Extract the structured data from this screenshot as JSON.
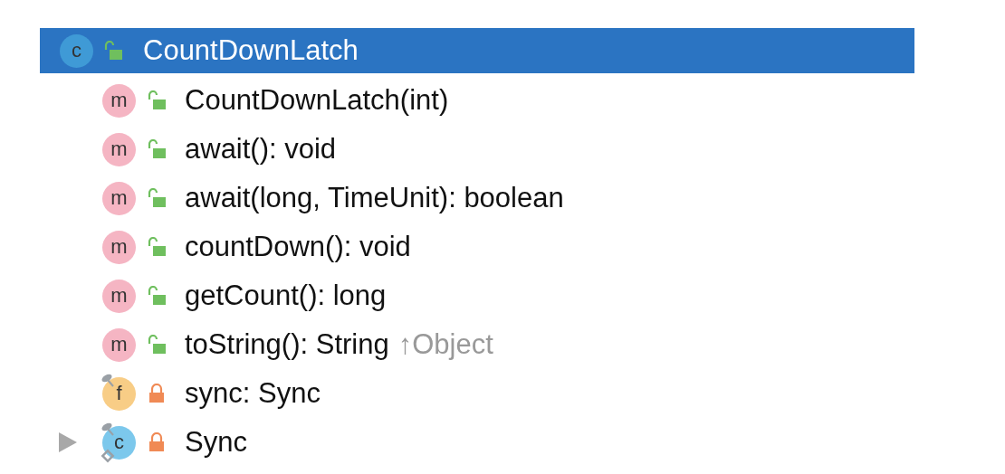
{
  "tree": {
    "kind": "class",
    "badge": "c",
    "private": false,
    "label": "CountDownLatch",
    "selected": true,
    "children": [
      {
        "kind": "method",
        "badge": "m",
        "private": false,
        "label": "CountDownLatch(int)",
        "selected": false,
        "final": false,
        "static": false
      },
      {
        "kind": "method",
        "badge": "m",
        "private": false,
        "label": "await(): void",
        "selected": false,
        "final": false,
        "static": false
      },
      {
        "kind": "method",
        "badge": "m",
        "private": false,
        "label": "await(long, TimeUnit): boolean",
        "selected": false,
        "final": false,
        "static": false
      },
      {
        "kind": "method",
        "badge": "m",
        "private": false,
        "label": "countDown(): void",
        "selected": false,
        "final": false,
        "static": false
      },
      {
        "kind": "method",
        "badge": "m",
        "private": false,
        "label": "getCount(): long",
        "selected": false,
        "final": false,
        "static": false
      },
      {
        "kind": "method",
        "badge": "m",
        "private": false,
        "label": "toString(): String",
        "suffix": "↑Object",
        "selected": false,
        "final": false,
        "static": false
      },
      {
        "kind": "field",
        "badge": "f",
        "private": true,
        "label": "sync: Sync",
        "selected": false,
        "final": true,
        "static": false
      },
      {
        "kind": "class",
        "badge": "c",
        "private": true,
        "label": "Sync",
        "selected": false,
        "final": true,
        "static": true,
        "expanded": false
      }
    ]
  }
}
